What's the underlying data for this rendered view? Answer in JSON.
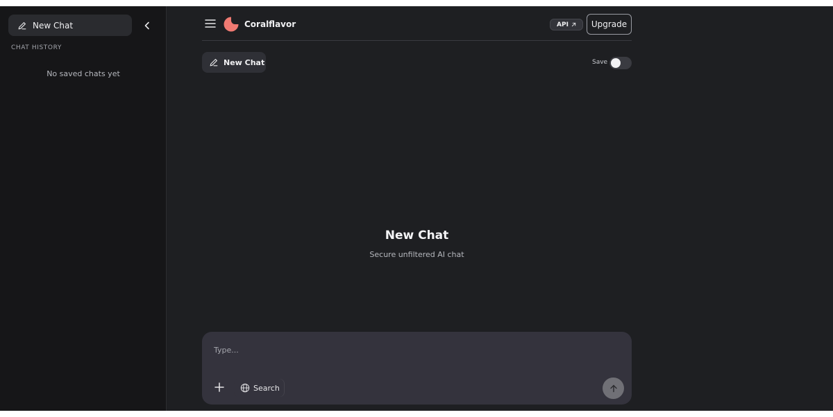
{
  "sidebar": {
    "new_chat_label": "New Chat",
    "history_heading": "CHAT HISTORY",
    "empty_message": "No saved chats yet"
  },
  "header": {
    "brand_name": "Coralflavor",
    "api_label": "API",
    "upgrade_label": "Upgrade"
  },
  "toolbar": {
    "new_chat_label": "New Chat",
    "save_label": "Save",
    "save_enabled": false
  },
  "hero": {
    "title": "New Chat",
    "subtitle": "Secure unfiltered AI chat"
  },
  "composer": {
    "placeholder": "Type...",
    "value": "",
    "search_label": "Search"
  },
  "colors": {
    "accent_logo": "#f07a72",
    "background": "#1e1f22",
    "sidebar_bg": "#161618",
    "composer_bg": "#34333d"
  },
  "icons": [
    "pencil-icon",
    "chevron-left-icon",
    "menu-icon",
    "logo-icon",
    "external-arrow-icon",
    "plus-icon",
    "globe-icon",
    "arrow-up-icon"
  ]
}
